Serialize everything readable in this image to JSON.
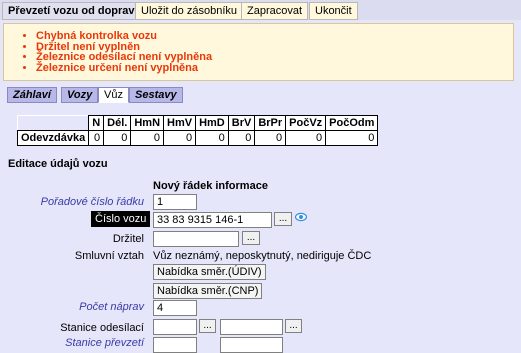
{
  "menu": {
    "items": [
      "Převzetí vozu od dopravce",
      "Uložit do zásobníku",
      "Zapracovat",
      "Ukončit"
    ]
  },
  "errors": [
    "Chybná kontrolka vozu",
    "Držitel není vyplněn",
    "Železnice odesílací není vyplněna",
    "Železnice určení není vyplněna"
  ],
  "tabs": [
    "Záhlaví",
    "Vozy",
    "Vůz",
    "Sestavy"
  ],
  "summary": {
    "headers": [
      "N",
      "Dél.",
      "HmN",
      "HmV",
      "HmD",
      "BrV",
      "BrPr",
      "PočVz",
      "PočOdm"
    ],
    "row_label": "Odevzdávka",
    "values": [
      "0",
      "0",
      "0",
      "0",
      "0",
      "0",
      "0",
      "0",
      "0"
    ]
  },
  "section_title": "Editace údajů vozu",
  "form": {
    "heading": "Nový řádek informace",
    "row_number": {
      "label": "Pořadové číslo řádku",
      "value": "1"
    },
    "wagon_number": {
      "label": "Číslo vozu",
      "value": "33 83 9315 146-1",
      "lookup": "..."
    },
    "holder": {
      "label": "Držitel",
      "value": "",
      "lookup": "..."
    },
    "contract": {
      "label": "Smluvní vztah",
      "value": "Vůz neznámý, neposkytnutý, nediriguje ČDC",
      "btn_udiv": "Nabídka směr.(ÚDIV)",
      "btn_cnp": "Nabídka směr.(CNP)"
    },
    "axles": {
      "label": "Počet náprav",
      "value": "4"
    },
    "sending_station": {
      "label": "Stanice odesílací",
      "lookup1": "...",
      "lookup2": "..."
    },
    "receiving_station": {
      "label": "Stanice převzetí"
    }
  },
  "colors": {
    "background": "#E6E6FA",
    "error_text": "#E8380A",
    "error_box": "#FFF8DC",
    "tab_inactive": "#B8B8E8",
    "label_italic": "#3A3AA8",
    "eye_icon": "#2F8FE0"
  }
}
